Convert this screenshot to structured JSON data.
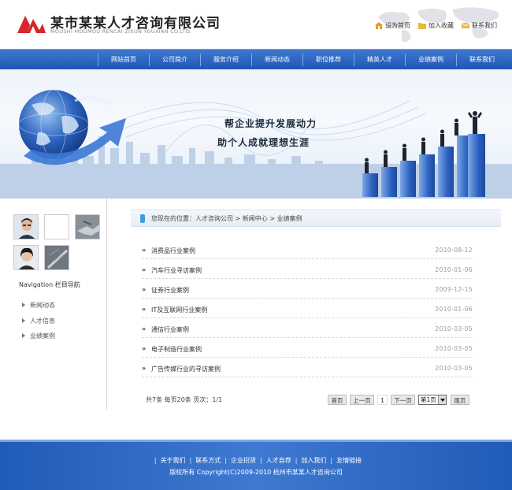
{
  "header": {
    "logo_cn": "某市某某人才咨询有限公司",
    "logo_en": "MOUSHI MOUMOU RENCAI ZIXUN YOUXIAN CO.LTD.",
    "links": [
      {
        "label": "设为首页",
        "icon": "home-icon"
      },
      {
        "label": "加入收藏",
        "icon": "folder-icon"
      },
      {
        "label": "联系我们",
        "icon": "mail-icon"
      }
    ]
  },
  "nav": {
    "items": [
      "网站首页",
      "公司简介",
      "服务介绍",
      "新闻动态",
      "职位推荐",
      "精英人才",
      "业绩案例",
      "联系我们"
    ]
  },
  "banner": {
    "slogan1": "帮企业提升发展动力",
    "slogan2": "助个人成就理想生涯"
  },
  "sidebar": {
    "title": "Navigation  栏目导航",
    "items": [
      "新闻动态",
      "人才信息",
      "业绩案例"
    ]
  },
  "breadcrumb": "您现在的位置：人才咨询公司 > 新闻中心 > 业绩案例",
  "list": [
    {
      "mark": "»",
      "title": "消费品行业案例",
      "date": "2010-08-12"
    },
    {
      "mark": "»",
      "title": "汽车行业寻访案例",
      "date": "2010-01-06"
    },
    {
      "mark": "»",
      "title": "证券行业案例",
      "date": "2009-12-15"
    },
    {
      "mark": "»",
      "title": "IT及互联网行业案例",
      "date": "2010-01-06"
    },
    {
      "mark": "»",
      "title": "通信行业案例",
      "date": "2010-03-05"
    },
    {
      "mark": "»",
      "title": "电子制造行业案例",
      "date": "2010-03-05"
    },
    {
      "mark": "»",
      "title": "广告传媒行业的寻访案例",
      "date": "2010-03-05"
    }
  ],
  "pagination": {
    "info": "共7条  每页20条  页次：1/1",
    "first": "首页",
    "prev": "上一页",
    "current": "1",
    "next": "下一页",
    "select_value": "第1页",
    "last": "尾页"
  },
  "footer": {
    "links": [
      "关于我们",
      "联系方式",
      "企业招贤",
      "人才自荐",
      "加入我们",
      "友情链接"
    ],
    "separator": "|",
    "copyright": "版权所有  Copyright(C)2009-2010 杭州市某某人才咨询公司"
  },
  "colors": {
    "nav_blue": "#2a63c2",
    "footer_blue": "#2b67c4",
    "logo_red": "#d8242a"
  }
}
